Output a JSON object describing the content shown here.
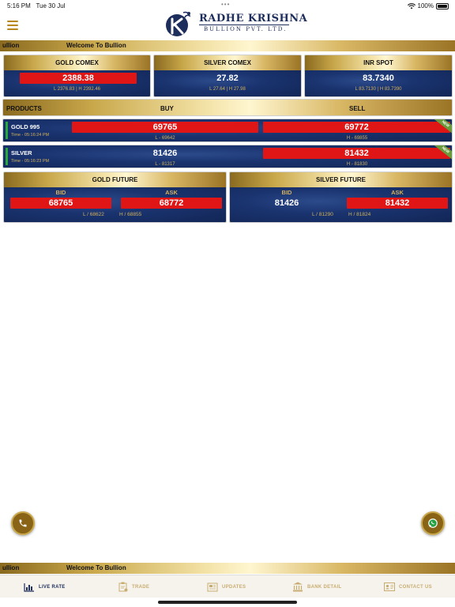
{
  "status": {
    "time": "5:16 PM",
    "date": "Tue 30 Jul",
    "battery": "100%"
  },
  "brand": {
    "title": "RADHE KRISHNA",
    "subtitle": "BULLION PVT. LTD."
  },
  "ticker": {
    "left": "ullion",
    "text": "Welcome To Bullion"
  },
  "markets": {
    "gold_comex": {
      "title": "GOLD COMEX",
      "value": "2388.38",
      "range": "L 2376.83 | H 2392.46"
    },
    "silver_comex": {
      "title": "SILVER COMEX",
      "value": "27.82",
      "range": "L 27.64 | H 27.98"
    },
    "inr_spot": {
      "title": "INR SPOT",
      "value": "83.7340",
      "range": "L 83.7130 | H 83.7390"
    }
  },
  "products": {
    "headers": {
      "product": "PRODUCTS",
      "buy": "BUY",
      "sell": "SELL"
    },
    "rows": [
      {
        "name": "GOLD 995",
        "time": "Time - 05:16:24 PM",
        "buy": "69765",
        "sell": "69772",
        "low": "L - 69642",
        "high": "H - 69855",
        "badge": "NEW"
      },
      {
        "name": "SILVER",
        "time": "Time - 05:16:23 PM",
        "buy": "81426",
        "sell": "81432",
        "low": "L - 81317",
        "high": "H - 81830",
        "badge": "NEW"
      }
    ]
  },
  "futures": {
    "gold": {
      "title": "GOLD FUTURE",
      "bid_label": "BID",
      "ask_label": "ASK",
      "bid": "68765",
      "ask": "68772",
      "low": "L / 68622",
      "high": "H / 68855"
    },
    "silver": {
      "title": "SILVER FUTURE",
      "bid_label": "BID",
      "ask_label": "ASK",
      "bid": "81426",
      "ask": "81432",
      "low": "L / 81290",
      "high": "H / 81824"
    }
  },
  "tabs": [
    {
      "label": "LIVE RATE",
      "icon": "chart-icon",
      "active": true
    },
    {
      "label": "TRADE",
      "icon": "clipboard-icon",
      "active": false
    },
    {
      "label": "UPDATES",
      "icon": "news-icon",
      "active": false
    },
    {
      "label": "BANK DETAIL",
      "icon": "bank-icon",
      "active": false
    },
    {
      "label": "CONTACT US",
      "icon": "contact-card-icon",
      "active": false
    }
  ],
  "colors": {
    "gold": "#c9a84b",
    "navy": "#1a3470",
    "price_red": "#e01515",
    "brand_navy": "#1d2d5c"
  }
}
